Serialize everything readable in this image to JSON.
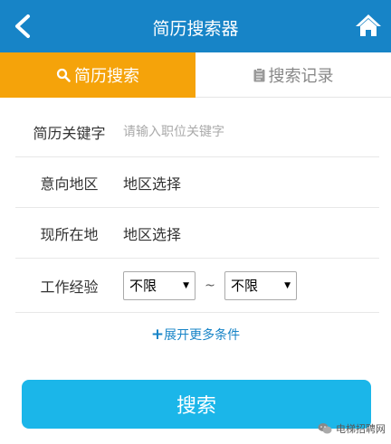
{
  "header": {
    "title": "简历搜索器",
    "back_icon": "back-chevron-icon",
    "home_icon": "home-icon"
  },
  "tabs": [
    {
      "label": "简历搜索",
      "icon": "search-icon",
      "active": true
    },
    {
      "label": "搜索记录",
      "icon": "clipboard-icon",
      "active": false
    }
  ],
  "form": {
    "keyword": {
      "label": "简历关键字",
      "value": "",
      "placeholder": "请输入职位关键字"
    },
    "intended_area": {
      "label": "意向地区",
      "value": "地区选择"
    },
    "current_location": {
      "label": "现所在地",
      "value": "地区选择"
    },
    "experience": {
      "label": "工作经验",
      "from": "不限",
      "separator": "~",
      "to": "不限"
    }
  },
  "more_conditions": {
    "plus": "+",
    "label": "展开更多条件"
  },
  "search_button": {
    "label": "搜索"
  },
  "watermark": {
    "text": "电梯招聘网",
    "icon": "wechat-icon"
  },
  "colors": {
    "header_bg": "#1784c7",
    "active_tab": "#f5a30a",
    "button": "#1bb6e9",
    "link": "#1784c7"
  }
}
